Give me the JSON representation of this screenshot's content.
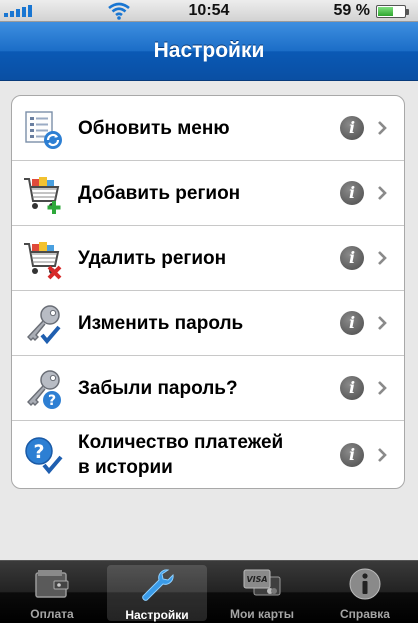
{
  "status_bar": {
    "time": "10:54",
    "battery_percent": "59 %",
    "battery_level": 0.59
  },
  "nav": {
    "title": "Настройки"
  },
  "settings": {
    "items": [
      {
        "label": "Обновить меню",
        "icon": "refresh-menu-icon"
      },
      {
        "label": "Добавить регион",
        "icon": "cart-add-icon"
      },
      {
        "label": "Удалить регион",
        "icon": "cart-remove-icon"
      },
      {
        "label": "Изменить пароль",
        "icon": "key-check-icon"
      },
      {
        "label": "Забыли пароль?",
        "icon": "key-question-icon"
      },
      {
        "label": "Количество платежей в истории",
        "label_line1": "Количество платежей",
        "label_line2": "в истории",
        "icon": "question-check-icon"
      }
    ],
    "info_glyph": "i"
  },
  "tab_bar": {
    "tabs": [
      {
        "label": "Оплата",
        "icon": "wallet-icon",
        "active": false
      },
      {
        "label": "Настройки",
        "icon": "wrench-icon",
        "active": true
      },
      {
        "label": "Мои карты",
        "icon": "cards-icon",
        "card_text": "VISA",
        "active": false
      },
      {
        "label": "Справка",
        "icon": "info-icon",
        "active": false
      }
    ]
  },
  "colors": {
    "nav_blue": "#1b6dc7",
    "tab_active_icon": "#3a9be8"
  }
}
